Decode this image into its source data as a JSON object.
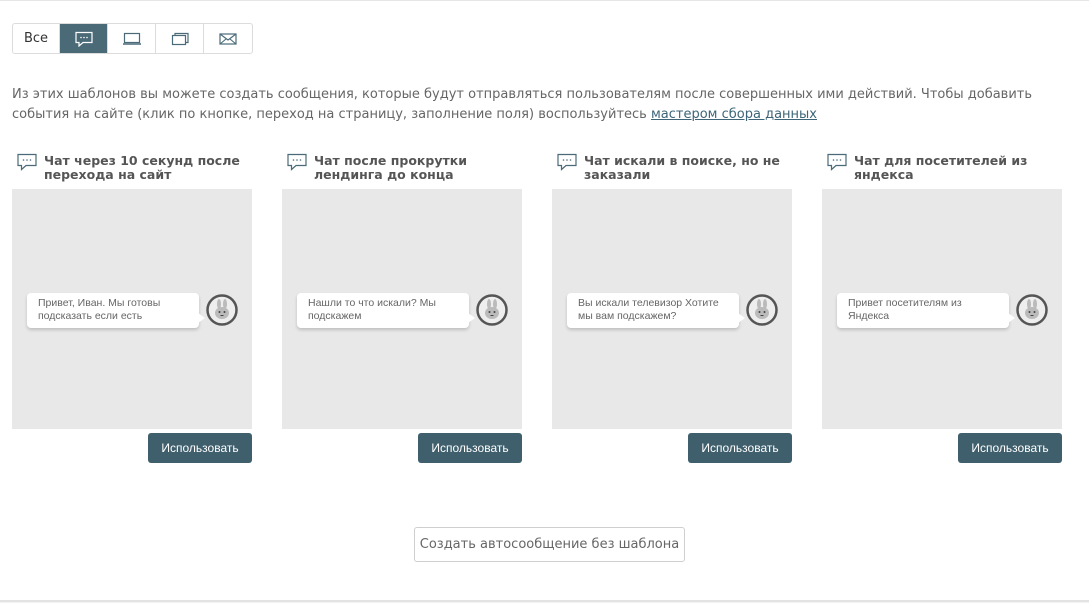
{
  "filters": {
    "all_label": "Все",
    "tabs": [
      {
        "icon": "chat-bubble-icon",
        "active": true
      },
      {
        "icon": "monitor-icon",
        "active": false
      },
      {
        "icon": "popup-window-icon",
        "active": false
      },
      {
        "icon": "envelope-icon",
        "active": false
      }
    ]
  },
  "description": {
    "text": "Из этих шаблонов вы можете создать сообщения, которые будут отправляться пользователям после совершенных ими действий. Чтобы добавить события на сайте (клик по кнопке, переход на страницу, заполнение поля) воспользуйтесь ",
    "link_text": "мастером сбора данных"
  },
  "templates": [
    {
      "title": "Чат через 10 секунд после перехода на сайт",
      "message": "Привет, Иван. Мы готовы подсказать если есть",
      "button": "Использовать"
    },
    {
      "title": "Чат после прокрутки лендинга до конца",
      "message": "Нашли то что искали? Мы подскажем",
      "button": "Использовать"
    },
    {
      "title": "Чат искали в поиске, но не заказали",
      "message": "Вы искали телевизор Хотите мы вам подскажем?",
      "button": "Использовать"
    },
    {
      "title": "Чат для посетителей из яндекса",
      "message": "Привет посетителям из Яндекса",
      "button": "Использовать"
    }
  ],
  "create_button": "Создать автосообщение без шаблона",
  "colors": {
    "accent": "#4a6a78",
    "button": "#3f5f6d",
    "preview_bg": "#e8e8e8"
  }
}
